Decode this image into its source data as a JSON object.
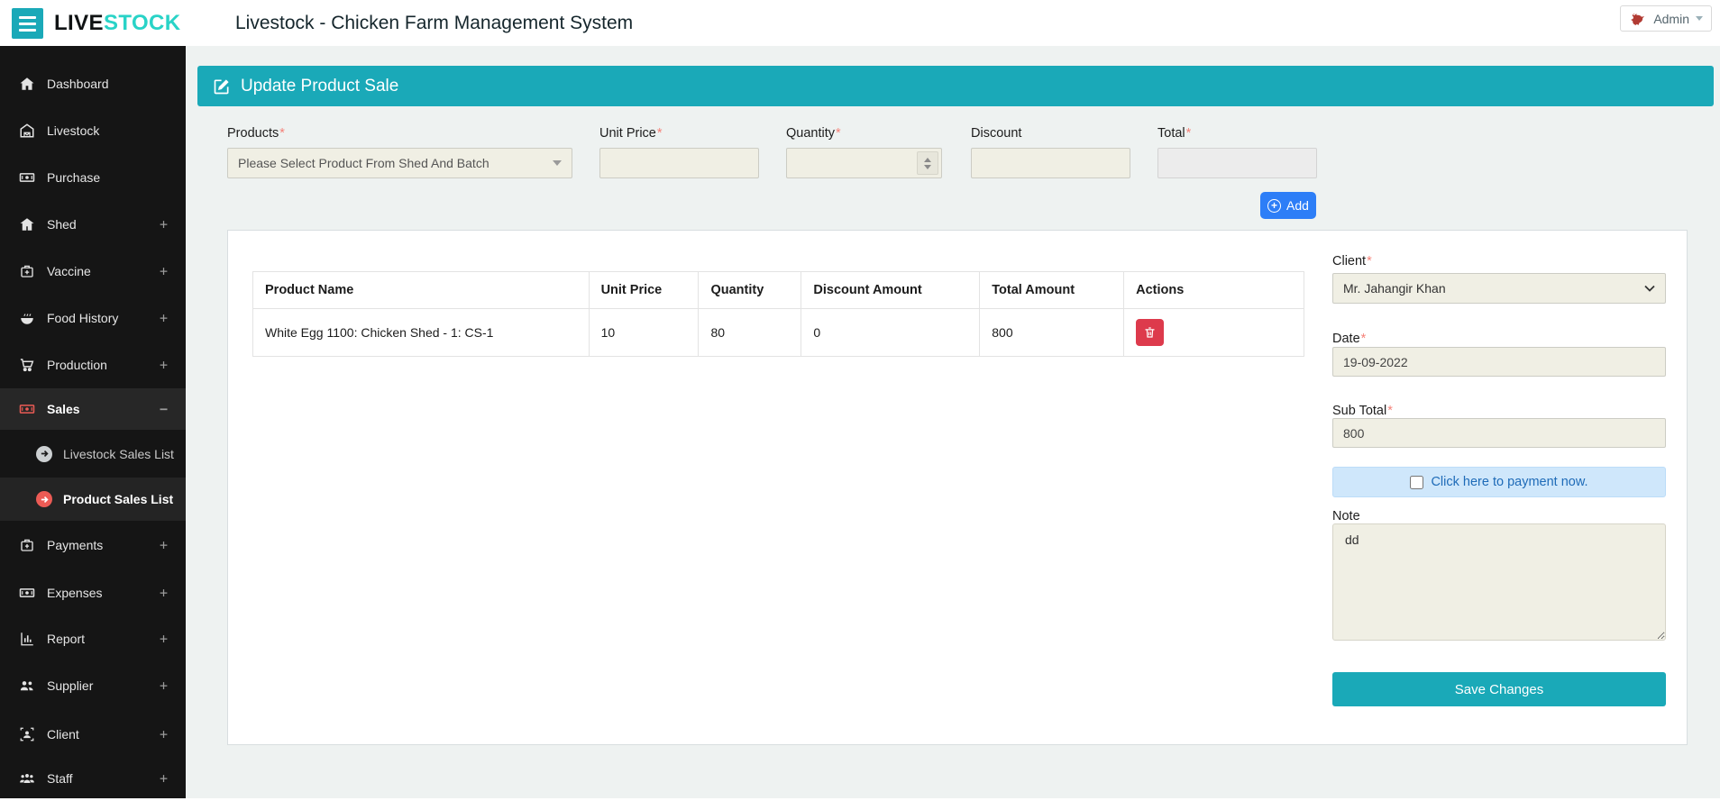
{
  "topbar": {
    "logo_prefix": "LIVE",
    "logo_suffix": "STOCK",
    "title": "Livestock - Chicken Farm Management System",
    "admin_label": "Admin"
  },
  "ui": {
    "required_marker": "*"
  },
  "colors": {
    "teal": "#1aa9b8",
    "logo_teal": "#29d3c7",
    "sidebar_bg": "#151515",
    "accent_red": "#ec5b55",
    "delete_red": "#dd3a4c",
    "add_blue": "#2d7ef7",
    "payment_bg": "#cfe7fb",
    "payment_text": "#1e6bb8",
    "field_beige": "#f0efe4",
    "content_bg": "#eef2f1"
  },
  "sidebar": {
    "items": [
      {
        "label": "Dashboard",
        "expander": ""
      },
      {
        "label": "Livestock",
        "expander": ""
      },
      {
        "label": "Purchase",
        "expander": ""
      },
      {
        "label": "Shed",
        "expander": "+"
      },
      {
        "label": "Vaccine",
        "expander": "+"
      },
      {
        "label": "Food History",
        "expander": "+"
      },
      {
        "label": "Production",
        "expander": "+"
      },
      {
        "label": "Sales",
        "expander": "−",
        "active": true,
        "expanded": true
      },
      {
        "label": "Livestock Sales List"
      },
      {
        "label": "Product Sales List",
        "active": true
      },
      {
        "label": "Payments",
        "expander": "+"
      },
      {
        "label": "Expenses",
        "expander": "+"
      },
      {
        "label": "Report",
        "expander": "+"
      },
      {
        "label": "Supplier",
        "expander": "+"
      },
      {
        "label": "Client",
        "expander": "+"
      },
      {
        "label": "Staff",
        "expander": "+"
      }
    ]
  },
  "panel": {
    "title": "Update Product Sale"
  },
  "form": {
    "products": {
      "label": "Products",
      "required": true,
      "value": "Please Select Product From Shed And Batch"
    },
    "unit_price": {
      "label": "Unit Price",
      "required": true,
      "value": ""
    },
    "quantity": {
      "label": "Quantity",
      "required": true,
      "value": ""
    },
    "discount": {
      "label": "Discount",
      "required": false,
      "value": ""
    },
    "total": {
      "label": "Total",
      "required": true,
      "value": ""
    },
    "add_label": "Add"
  },
  "table": {
    "headers": [
      "Product Name",
      "Unit Price",
      "Quantity",
      "Discount Amount",
      "Total Amount",
      "Actions"
    ],
    "rows": [
      {
        "product_name": "White Egg 1100: Chicken Shed - 1: CS-1",
        "unit_price": "10",
        "quantity": "80",
        "discount_amount": "0",
        "total_amount": "800"
      }
    ]
  },
  "summary": {
    "client_label": "Client",
    "client_value": "Mr. Jahangir Khan",
    "date_label": "Date",
    "date_value": "19-09-2022",
    "sub_total_label": "Sub Total",
    "sub_total_value": "800",
    "payment_checkbox_label": "Click here to payment now.",
    "payment_checked": false,
    "note_label": "Note",
    "note_value": "dd",
    "save_label": "Save Changes"
  }
}
